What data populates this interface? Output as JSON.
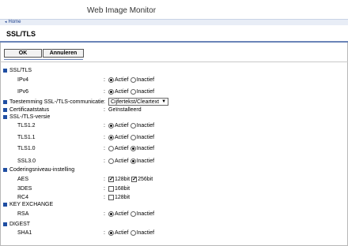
{
  "app": {
    "title": "Web Image Monitor"
  },
  "nav": {
    "home_label": "Home"
  },
  "page": {
    "title": "SSL/TLS"
  },
  "buttons": {
    "ok": "OK",
    "cancel": "Annuleren"
  },
  "protocol_labels": {
    "enable": "Actief",
    "disable": "Inactief"
  },
  "sections": {
    "ssl_tls": {
      "label": "SSL/TLS",
      "ipv4": {
        "label": "IPv4",
        "value": "Actief"
      },
      "ipv6": {
        "label": "IPv6",
        "value": "Actief"
      }
    },
    "permit": {
      "label": "Toestemming SSL-/TLS-communicatie",
      "selected": "Cijfertekst/Cleartext"
    },
    "certificate": {
      "label": "Certificaatstatus",
      "value": "Geïnstalleerd"
    },
    "version": {
      "label": "SSL-/TLS-versie",
      "items": [
        {
          "label": "TLS1.2",
          "value": "Actief"
        },
        {
          "label": "TLS1.1",
          "value": "Actief"
        },
        {
          "label": "TLS1.0",
          "value": "Inactief"
        },
        {
          "label": "SSL3.0",
          "value": "Inactief"
        }
      ]
    },
    "encryption": {
      "label": "Coderingsniveau-instelling",
      "aes": {
        "label": "AES",
        "opt1": "128bit",
        "opt1_checked": true,
        "opt2": "256bit",
        "opt2_checked": true
      },
      "des": {
        "label": "3DES",
        "opt1": "168bit",
        "opt1_checked": false
      },
      "rc4": {
        "label": "RC4",
        "opt1": "128bit",
        "opt1_checked": false
      }
    },
    "key_exchange": {
      "label": "KEY EXCHANGE",
      "rsa": {
        "label": "RSA",
        "value": "Actief"
      }
    },
    "digest": {
      "label": "DIGEST",
      "sha1": {
        "label": "SHA1",
        "value": "Actief"
      }
    }
  },
  "colors": {
    "accent": "#1f4ea2",
    "nav_bg": "#e8edf6",
    "rule": "#6a84b8"
  }
}
